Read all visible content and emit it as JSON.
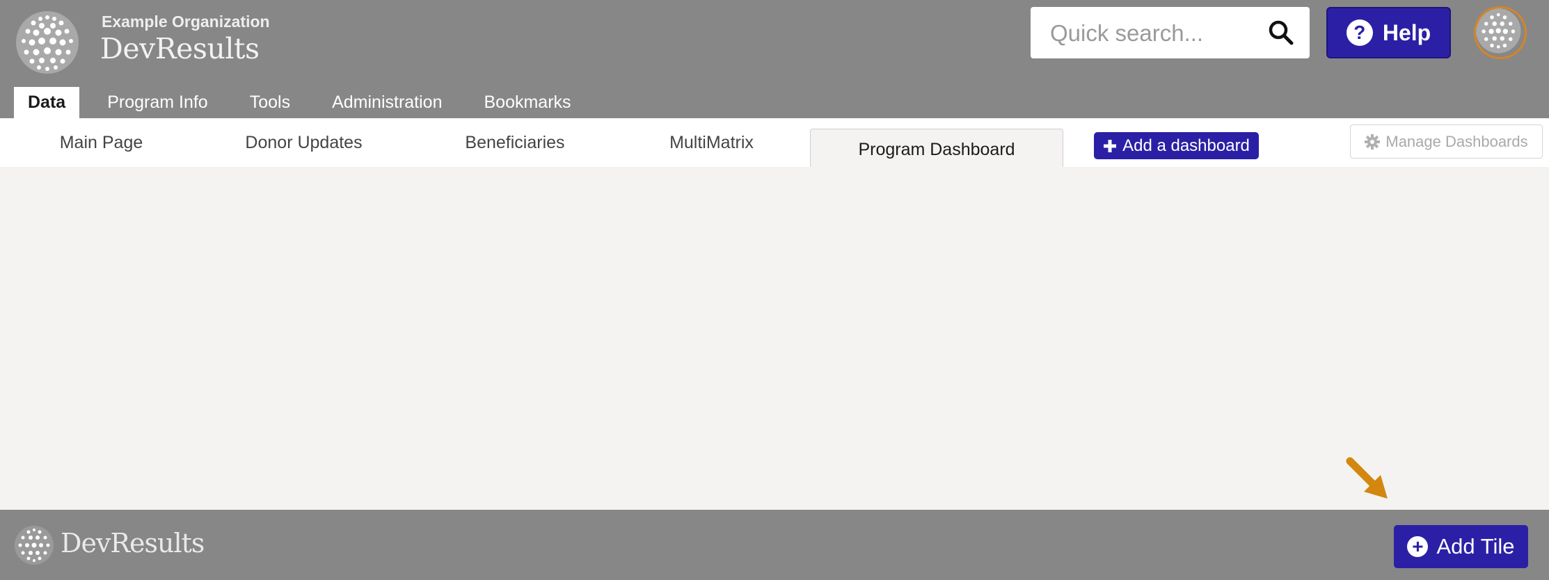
{
  "header": {
    "org_name": "Example Organization",
    "app_name": "DevResults",
    "search": {
      "placeholder": "Quick search..."
    },
    "help_label": "Help"
  },
  "main_tabs": [
    {
      "label": "Data",
      "active": true
    },
    {
      "label": "Program Info"
    },
    {
      "label": "Tools"
    },
    {
      "label": "Administration"
    },
    {
      "label": "Bookmarks"
    }
  ],
  "dashboard_tabs": [
    {
      "label": "Main Page"
    },
    {
      "label": "Donor Updates"
    },
    {
      "label": "Beneficiaries"
    },
    {
      "label": "MultiMatrix"
    },
    {
      "label": "Program Dashboard",
      "active": true
    }
  ],
  "add_dashboard_label": "Add a dashboard",
  "manage_dashboards_label": "Manage Dashboards",
  "footer": {
    "app_name": "DevResults",
    "add_tile_label": "Add Tile"
  },
  "colors": {
    "header_bg": "#878787",
    "brand_button": "#2b20a5",
    "avatar_ring": "#d3852a",
    "annotation_arrow": "#d3870e"
  },
  "icons": [
    "globe-logo-icon",
    "search-icon",
    "question-circle-icon",
    "plus-icon",
    "gear-icon",
    "plus-circle-icon",
    "pointer-arrow-icon"
  ]
}
